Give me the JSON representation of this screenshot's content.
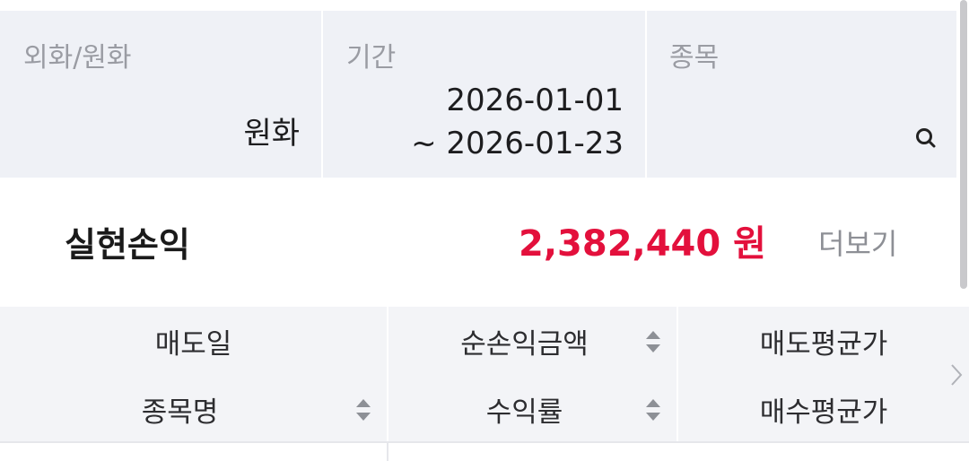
{
  "filters": {
    "currency_label": "외화/원화",
    "currency_value": "원화",
    "period_label": "기간",
    "period_start": "2026-01-01",
    "period_end": "~ 2026-01-23",
    "stock_label": "종목"
  },
  "summary": {
    "label": "실현손익",
    "amount": "2,382,440 원",
    "more_label": "더보기"
  },
  "table": {
    "row1": [
      "매도일",
      "순손익금액",
      "매도평균가"
    ],
    "row2": [
      "종목명",
      "수익률",
      "매수평균가"
    ]
  },
  "icons": {
    "search": "search-icon",
    "sort": "sort-updown-icon",
    "next": "chevron-right-icon"
  },
  "colors": {
    "profit": "#e3103c",
    "filter_bg": "#eff1f6"
  }
}
